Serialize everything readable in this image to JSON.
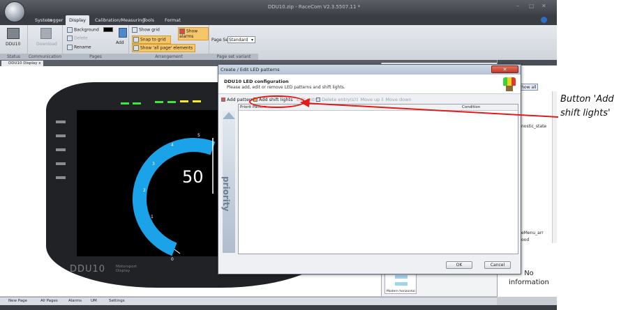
{
  "app": {
    "title": "DDU10.zip - RaceCom V2.3.5507.11 *",
    "menu_tabs": [
      "System",
      "Logger",
      "Display",
      "Calibration/Measuring",
      "Tools",
      "Format"
    ]
  },
  "ribbon": {
    "status_group": {
      "button": "DDU10",
      "label": "Status"
    },
    "communication_group": {
      "button": "Download",
      "label": "Communication"
    },
    "pages_group": {
      "background": "Background",
      "delete": "Delete",
      "rename": "Rename",
      "add": "Add",
      "label": "Pages"
    },
    "arrangement_group": {
      "show_grid": "Show grid",
      "snap_to_grid": "Snap to grid",
      "show_all_page": "Show 'all page' elements",
      "show_alarms": "Show alarms",
      "label": "Arrangement"
    },
    "page_set_group": {
      "label_text": "Page Set",
      "value": "Standard",
      "label": "Page set variant"
    }
  },
  "doc_tab": {
    "label": "DDU10 Display",
    "close": "x"
  },
  "dashboard": {
    "speed": "50",
    "brand": "DDU10",
    "brand_sub1": "Motorsport",
    "brand_sub2": "Display",
    "ticks": [
      "0",
      "1",
      "2",
      "3",
      "4",
      "5"
    ]
  },
  "dialog": {
    "title": "Create / Edit LED patterns",
    "heading": "DDU10 LED configuration",
    "subheading": "Please add, edit or remove LED patterns and shift lights.",
    "toolbar": {
      "add_pattern": "Add pattern",
      "add_shift_lights": "Add shift lights",
      "edit_entry": "Edit entry",
      "delete_entries": "Delete entry(s)",
      "move_up": "Move up",
      "move_down": "Move down"
    },
    "columns": [
      "Priority",
      "Pattern",
      "Condition"
    ],
    "priority_label": "priority",
    "ok": "OK",
    "cancel": "Cancel"
  },
  "right_panel": {
    "show_all": "Show all",
    "item1": "nostic_state",
    "item2": "eMenu_arr",
    "item3": "ood",
    "info": "No information",
    "toolbox_label": "Modern horizontal"
  },
  "bottom_tabs": [
    "New Page",
    "All Pages",
    "Alarms",
    "UM",
    "Settings"
  ],
  "annotation": {
    "text": "Button 'Add shift lights'",
    "color": "#e11a1a"
  }
}
